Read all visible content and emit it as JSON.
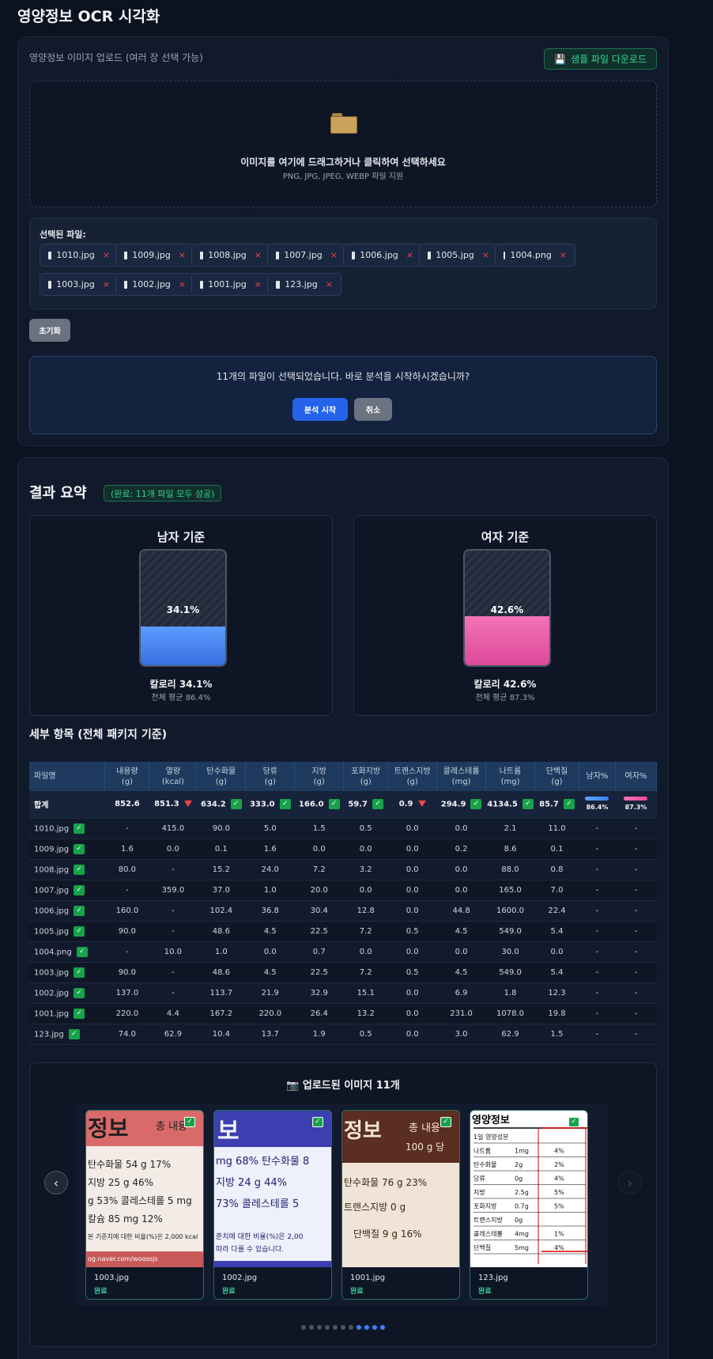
{
  "page_title": "영양정보 OCR 시각화",
  "upload": {
    "label": "영양정보 이미지 업로드 (여러 장 선택 가능)",
    "sample_button": "샘플 파일 다운로드",
    "drop_text": "이미지를 여기에 드래그하거나 클릭하여 선택하세요",
    "drop_sub": "PNG, JPG, JPEG, WEBP 파일 지원",
    "selected_label": "선택된 파일:",
    "files": [
      "1010.jpg",
      "1009.jpg",
      "1008.jpg",
      "1007.jpg",
      "1006.jpg",
      "1005.jpg",
      "1004.png",
      "1003.jpg",
      "1002.jpg",
      "1001.jpg",
      "123.jpg"
    ],
    "reset_button": "초기화",
    "confirm_text": "11개의 파일이 선택되었습니다. 바로 분석을 시작하시겠습니까?",
    "start_button": "분석 시작",
    "cancel_button": "취소"
  },
  "summary": {
    "title": "결과 요약",
    "badge": "(완료: 11개 파일 모두 성공)",
    "male": {
      "title": "남자 기준",
      "percent_label": "34.1%",
      "fill_percent": 34.1,
      "calorie": "칼로리 34.1%",
      "avg": "전체 평균 86.4%"
    },
    "female": {
      "title": "여자 기준",
      "percent_label": "42.6%",
      "fill_percent": 42.6,
      "calorie": "칼로리 42.6%",
      "avg": "전체 평균 87.3%"
    }
  },
  "detail": {
    "title": "세부 항목 (전체 패키지 기준)",
    "headers": [
      {
        "l1": "파일명",
        "l2": ""
      },
      {
        "l1": "내용량",
        "l2": "(g)"
      },
      {
        "l1": "열량",
        "l2": "(kcal)"
      },
      {
        "l1": "탄수화물",
        "l2": "(g)"
      },
      {
        "l1": "당류",
        "l2": "(g)"
      },
      {
        "l1": "지방",
        "l2": "(g)"
      },
      {
        "l1": "포화지방",
        "l2": "(g)"
      },
      {
        "l1": "트랜스지방",
        "l2": "(g)"
      },
      {
        "l1": "콜레스테롤",
        "l2": "(mg)"
      },
      {
        "l1": "나트륨",
        "l2": "(mg)"
      },
      {
        "l1": "단백질",
        "l2": "(g)"
      },
      {
        "l1": "남자%",
        "l2": ""
      },
      {
        "l1": "여자%",
        "l2": ""
      }
    ],
    "total": {
      "name": "합계",
      "cells": [
        {
          "v": "852.6",
          "mark": ""
        },
        {
          "v": "851.3",
          "mark": "warn"
        },
        {
          "v": "634.2",
          "mark": "ok"
        },
        {
          "v": "333.0",
          "mark": "ok"
        },
        {
          "v": "166.0",
          "mark": "ok"
        },
        {
          "v": "59.7",
          "mark": "ok"
        },
        {
          "v": "0.9",
          "mark": "warn"
        },
        {
          "v": "294.9",
          "mark": "ok"
        },
        {
          "v": "4134.5",
          "mark": "ok"
        },
        {
          "v": "85.7",
          "mark": "ok"
        }
      ],
      "male_pct": "86.4%",
      "female_pct": "87.3%"
    },
    "rows": [
      {
        "name": "1010.jpg",
        "vals": [
          "-",
          "415.0",
          "90.0",
          "5.0",
          "1.5",
          "0.5",
          "0.0",
          "0.0",
          "2.1",
          "11.0",
          "-",
          "-"
        ]
      },
      {
        "name": "1009.jpg",
        "vals": [
          "1.6",
          "0.0",
          "0.1",
          "1.6",
          "0.0",
          "0.0",
          "0.0",
          "0.2",
          "8.6",
          "0.1",
          "-",
          "-"
        ]
      },
      {
        "name": "1008.jpg",
        "vals": [
          "80.0",
          "-",
          "15.2",
          "24.0",
          "7.2",
          "3.2",
          "0.0",
          "0.0",
          "88.0",
          "0.8",
          "-",
          "-"
        ]
      },
      {
        "name": "1007.jpg",
        "vals": [
          "-",
          "359.0",
          "37.0",
          "1.0",
          "20.0",
          "0.0",
          "0.0",
          "0.0",
          "165.0",
          "7.0",
          "-",
          "-"
        ]
      },
      {
        "name": "1006.jpg",
        "vals": [
          "160.0",
          "-",
          "102.4",
          "36.8",
          "30.4",
          "12.8",
          "0.0",
          "44.8",
          "1600.0",
          "22.4",
          "-",
          "-"
        ]
      },
      {
        "name": "1005.jpg",
        "vals": [
          "90.0",
          "-",
          "48.6",
          "4.5",
          "22.5",
          "7.2",
          "0.5",
          "4.5",
          "549.0",
          "5.4",
          "-",
          "-"
        ]
      },
      {
        "name": "1004.png",
        "vals": [
          "-",
          "10.0",
          "1.0",
          "0.0",
          "0.7",
          "0.0",
          "0.0",
          "0.0",
          "30.0",
          "0.0",
          "-",
          "-"
        ]
      },
      {
        "name": "1003.jpg",
        "vals": [
          "90.0",
          "-",
          "48.6",
          "4.5",
          "22.5",
          "7.2",
          "0.5",
          "4.5",
          "549.0",
          "5.4",
          "-",
          "-"
        ]
      },
      {
        "name": "1002.jpg",
        "vals": [
          "137.0",
          "-",
          "113.7",
          "21.9",
          "32.9",
          "15.1",
          "0.0",
          "6.9",
          "1.8",
          "12.3",
          "-",
          "-"
        ]
      },
      {
        "name": "1001.jpg",
        "vals": [
          "220.0",
          "4.4",
          "167.2",
          "220.0",
          "26.4",
          "13.2",
          "0.0",
          "231.0",
          "1078.0",
          "19.8",
          "-",
          "-"
        ]
      },
      {
        "name": "123.jpg",
        "vals": [
          "74.0",
          "62.9",
          "10.4",
          "13.7",
          "1.9",
          "0.5",
          "0.0",
          "3.0",
          "62.9",
          "1.5",
          "-",
          "-"
        ]
      }
    ]
  },
  "gallery": {
    "title": "📷 업로드된 이미지 11개",
    "items": [
      {
        "name": "1003.jpg",
        "status": "완료"
      },
      {
        "name": "1002.jpg",
        "status": "완료"
      },
      {
        "name": "1001.jpg",
        "status": "완료"
      },
      {
        "name": "123.jpg",
        "status": "완료"
      }
    ],
    "dot_count": 11,
    "active_dots": [
      7,
      8,
      9,
      10
    ],
    "thumb1": {
      "lines": [
        "정보",
        "총 내용",
        "탄수화물 54 g 17%",
        "지방 25 g 46%",
        "g 53% 콜레스테롤 5 mg",
        "칼슘 85 mg 12%",
        "본 기준치에 대한 비율(%)은 2,000 kcal",
        "og.naver.com/wooosjs"
      ]
    },
    "thumb2": {
      "lines": [
        "보",
        "mg 68% 탄수화물 8",
        "지방 24 g 44%",
        "73% 콜레스테롤 5",
        "준치에 대한 비율(%)은 2,00",
        "따라 다를 수 있습니다."
      ]
    },
    "thumb3": {
      "lines": [
        "정보",
        "총 내용",
        "100 g 당",
        "탄수화물 76 g 23%",
        "트랜스지방 0 g",
        "단백질 9 g 16%"
      ]
    },
    "thumb4": {
      "title": "영양정보",
      "rows": [
        [
          "1일 영양성분",
          "",
          ""
        ],
        [
          "나트륨",
          "1mg",
          "4%"
        ],
        [
          "탄수화물",
          "2g",
          "2%"
        ],
        [
          "당류",
          "0g",
          "4%"
        ],
        [
          "지방",
          "2.5g",
          "5%"
        ],
        [
          "포화지방",
          "0.7g",
          "5%"
        ],
        [
          "트랜스지방",
          "0g",
          ""
        ],
        [
          "콜레스테롤",
          "4mg",
          "1%"
        ],
        [
          "단백질",
          "5mg",
          "4%"
        ]
      ]
    }
  }
}
